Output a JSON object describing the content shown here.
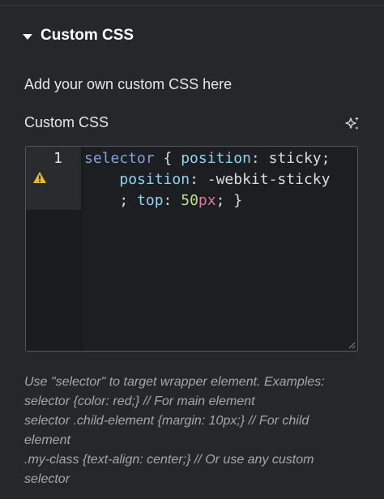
{
  "section": {
    "title": "Custom CSS",
    "expanded": true
  },
  "description": "Add your own custom CSS here",
  "field": {
    "label": "Custom CSS",
    "ai_icon": "sparkle-icon"
  },
  "editor": {
    "line_number": "1",
    "warning_icon": "warning-icon",
    "code_lines": [
      [
        {
          "text": "selector",
          "type": "sel"
        },
        {
          "text": " { ",
          "type": "punc"
        },
        {
          "text": "position",
          "type": "prop"
        },
        {
          "text": ": sticky;",
          "type": "val"
        }
      ],
      [
        {
          "text": "    ",
          "type": "punc"
        },
        {
          "text": "position",
          "type": "prop"
        },
        {
          "text": ": -webkit-sticky",
          "type": "val"
        }
      ],
      [
        {
          "text": "    ; ",
          "type": "punc"
        },
        {
          "text": "top",
          "type": "prop"
        },
        {
          "text": ": ",
          "type": "punc"
        },
        {
          "text": "50",
          "type": "num"
        },
        {
          "text": "px",
          "type": "unit"
        },
        {
          "text": "; }",
          "type": "punc"
        }
      ]
    ]
  },
  "help_lines": [
    "Use \"selector\" to target wrapper element. Examples:",
    "selector {color: red;} // For main element",
    "selector .child-element {margin: 10px;} // For child",
    "element",
    ".my-class {text-align: center;} // Or use any custom",
    "selector"
  ],
  "colors": {
    "background": "#26272b",
    "editor_bg": "#1d1e21",
    "selector": "#7ea4dc",
    "property": "#8fd3f0",
    "number": "#b5e08a",
    "unit": "#e7729e",
    "warning": "#e7b730"
  }
}
